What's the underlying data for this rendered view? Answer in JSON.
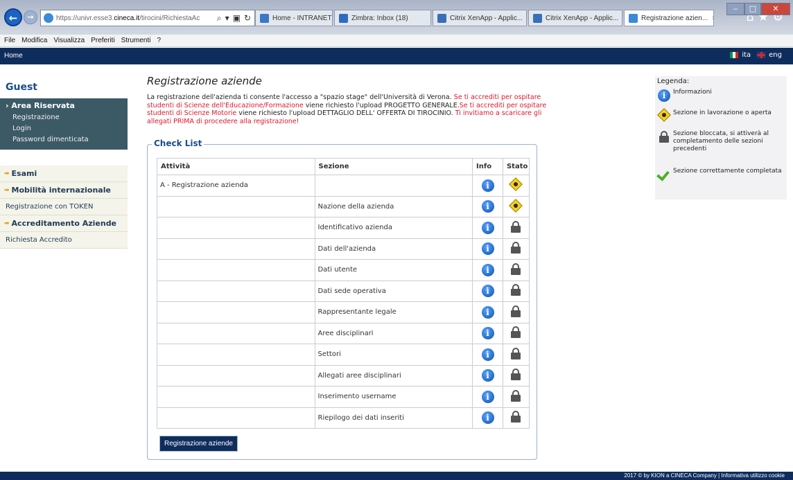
{
  "browser": {
    "url_prefix": "https://univr.esse3.",
    "url_domain": "cineca.it",
    "url_path": "/tirocini/RichiestaAc",
    "tabs": [
      {
        "label": "Home - INTRANET",
        "icon": "intranet-icon",
        "color": "#3b78c4"
      },
      {
        "label": "Zimbra: Inbox (18)",
        "icon": "zimbra-icon",
        "color": "#2d6cc0"
      },
      {
        "label": "Citrix XenApp - Applic...",
        "icon": "citrix-icon",
        "color": "#3a6fb8"
      },
      {
        "label": "Citrix XenApp - Applic...",
        "icon": "citrix-icon",
        "color": "#3a6fb8"
      },
      {
        "label": "Registrazione azien...",
        "icon": "ie-icon",
        "color": "#3a8ad8",
        "active": true
      }
    ],
    "menu": [
      "File",
      "Modifica",
      "Visualizza",
      "Preferiti",
      "Strumenti",
      "?"
    ]
  },
  "site": {
    "home_label": "Home",
    "lang_ita": "ita",
    "lang_eng": "eng"
  },
  "sidebar": {
    "guest": "Guest",
    "area_riservata": "Area Riservata",
    "area_links": [
      "Registrazione",
      "Login",
      "Password dimenticata"
    ],
    "esami": "Esami",
    "mobilita": "Mobilità internazionale",
    "registrazione_token": "Registrazione con TOKEN",
    "accreditamento": "Accreditamento Aziende",
    "richiesta": "Richiesta Accredito"
  },
  "main": {
    "title": "Registrazione aziende",
    "intro_1": "La registrazione dell'azienda ti consente l'accesso a \"spazio stage\" dell'Università di Verona. ",
    "intro_2": "Se ti accrediti per ospitare studenti di Scienze dell'Educazione/Formazione",
    "intro_3": " viene richiesto l'upload PROGETTO GENERALE.",
    "intro_4": "Se ti accrediti per ospitare studenti di Scienze Motorie",
    "intro_5": " viene richiesto l'upload DETTAGLIO DELL' OFFERTA DI TIROCINIO. ",
    "intro_6": "Ti invitiamo a scaricare gli allegati PRIMA di procedere alla registrazione!",
    "checklist_title": "Check List",
    "headers": {
      "attivita": "Attività",
      "sezione": "Sezione",
      "info": "Info",
      "stato": "Stato"
    },
    "rows": [
      {
        "attivita": "A - Registrazione azienda",
        "sezione": "",
        "stato": "in-progress"
      },
      {
        "attivita": "",
        "sezione": "Nazione della azienda",
        "stato": "in-progress"
      },
      {
        "attivita": "",
        "sezione": "Identificativo azienda",
        "stato": "locked"
      },
      {
        "attivita": "",
        "sezione": "Dati dell'azienda",
        "stato": "locked"
      },
      {
        "attivita": "",
        "sezione": "Dati utente",
        "stato": "locked"
      },
      {
        "attivita": "",
        "sezione": "Dati sede operativa",
        "stato": "locked"
      },
      {
        "attivita": "",
        "sezione": "Rappresentante legale",
        "stato": "locked"
      },
      {
        "attivita": "",
        "sezione": "Aree disciplinari",
        "stato": "locked"
      },
      {
        "attivita": "",
        "sezione": "Settori",
        "stato": "locked"
      },
      {
        "attivita": "",
        "sezione": "Allegati aree disciplinari",
        "stato": "locked"
      },
      {
        "attivita": "",
        "sezione": "Inserimento username",
        "stato": "locked"
      },
      {
        "attivita": "",
        "sezione": "Riepilogo dei dati inseriti",
        "stato": "locked"
      }
    ],
    "button": "Registrazione aziende"
  },
  "legend": {
    "title": "Legenda:",
    "info": "Informazioni",
    "in_progress": "Sezione in lavorazione o aperta",
    "locked": "Sezione bloccata, si attiverà al completamento delle sezioni precedenti",
    "done": "Sezione correttamente completata"
  },
  "footer": "2017 © by KION a CINECA Company | Informativa utilizzo cookie"
}
